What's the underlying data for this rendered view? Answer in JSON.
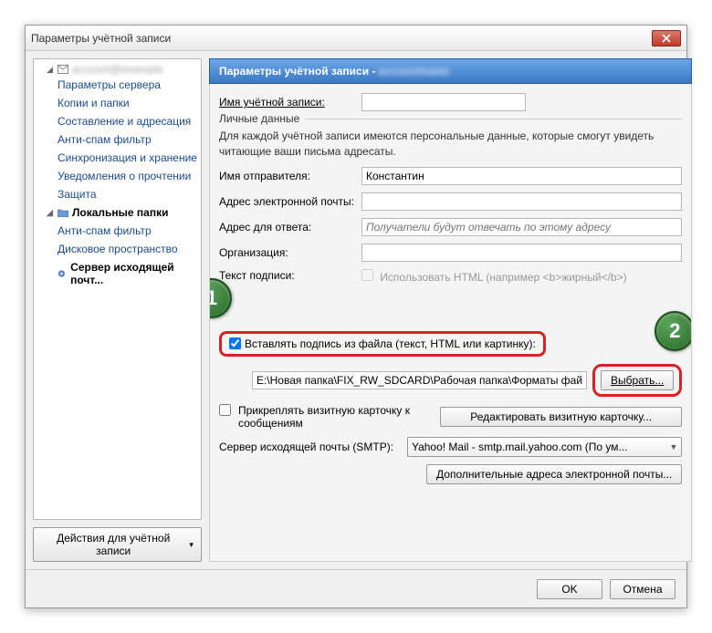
{
  "window": {
    "title": "Параметры учётной записи"
  },
  "sidebar": {
    "root": "",
    "items": [
      "Параметры сервера",
      "Копии и папки",
      "Составление и адресация",
      "Анти-спам фильтр",
      "Синхронизация и хранение",
      "Уведомления о прочтении",
      "Защита"
    ],
    "local_title": "Локальные папки",
    "local_items": [
      "Анти-спам фильтр",
      "Дисковое пространство"
    ],
    "smtp": "Сервер исходящей почт...",
    "action": "Действия для учётной записи"
  },
  "banner": {
    "title": "Параметры учётной записи - "
  },
  "form": {
    "account_name_label": "Имя учётной записи:",
    "account_name_value": "",
    "personal_legend": "Личные данные",
    "personal_help": "Для каждой учётной записи имеются персональные данные, которые смогут увидеть читающие ваши письма адресаты.",
    "sender_label": "Имя отправителя:",
    "sender_value": "Константин",
    "email_label": "Адрес электронной почты:",
    "email_value": "",
    "reply_label": "Адрес для ответа:",
    "reply_placeholder": "Получатели будут отвечать по этому адресу",
    "org_label": "Организация:",
    "sig_label": "Текст подписи:",
    "use_html": "Использовать HTML (например <b>жирный</b>)",
    "attach_from_file": "Вставлять подпись из файла (текст, HTML или картинку):",
    "file_path": "E:\\Новая папка\\FIX_RW_SDCARD\\Рабочая папка\\Форматы фай",
    "choose": "Выбрать...",
    "attach_vcard": "Прикреплять визитную карточку к сообщениям",
    "edit_vcard": "Редактировать визитную карточку...",
    "smtp_label": "Сервер исходящей почты (SMTP):",
    "smtp_value": "Yahoo! Mail - smtp.mail.yahoo.com (По ум...",
    "extra_addr": "Дополнительные адреса электронной почты..."
  },
  "buttons": {
    "ok": "OK",
    "cancel": "Отмена"
  },
  "badges": {
    "one": "1",
    "two": "2"
  }
}
